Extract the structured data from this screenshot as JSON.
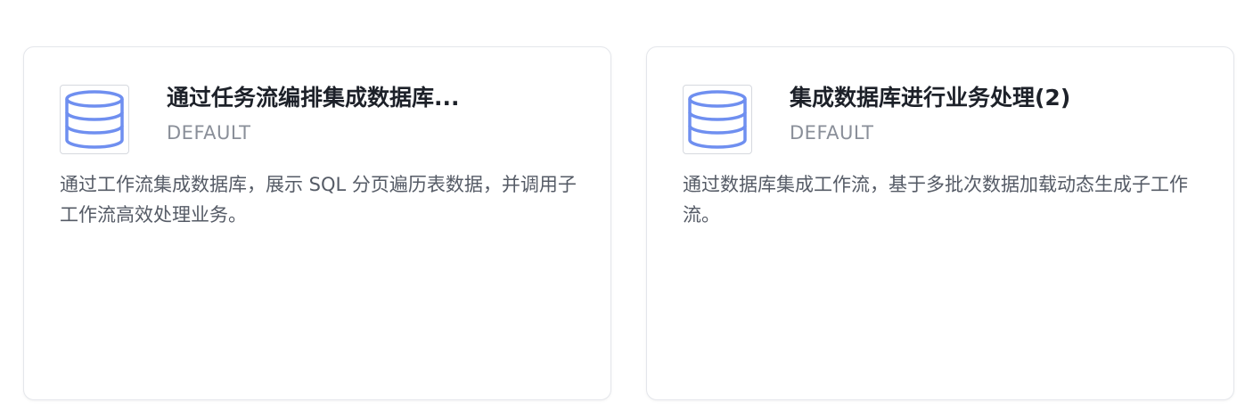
{
  "cards": [
    {
      "icon": "database-icon",
      "title": "通过任务流编排集成数据库...",
      "subtitle": "DEFAULT",
      "description": "通过工作流集成数据库，展示 SQL 分页遍历表数据，并调用子工作流高效处理业务。"
    },
    {
      "icon": "database-icon",
      "title": "集成数据库进行业务处理(2)",
      "subtitle": "DEFAULT",
      "description": "通过数据库集成工作流，基于多批次数据加载动态生成子工作流。"
    }
  ],
  "colors": {
    "icon_stroke": "#6f8ff0",
    "title": "#1d2129",
    "subtitle": "#8a8f99",
    "description": "#555b66",
    "card_border": "#e4e6eb"
  }
}
